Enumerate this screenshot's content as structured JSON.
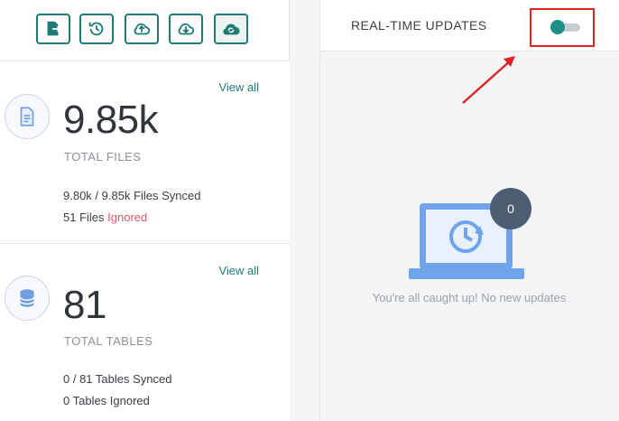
{
  "toolbar": {
    "buttons": [
      {
        "name": "export-file",
        "icon": "file-export-icon"
      },
      {
        "name": "restore",
        "icon": "history-icon"
      },
      {
        "name": "upload",
        "icon": "cloud-upload-icon"
      },
      {
        "name": "download",
        "icon": "cloud-download-icon"
      },
      {
        "name": "sync",
        "icon": "cloud-sync-icon"
      }
    ],
    "accent": "#1f7a75"
  },
  "files": {
    "view_all": "View all",
    "count": "9.85k",
    "label": "TOTAL FILES",
    "synced_count": "9.80k / 9.85k",
    "synced_text": "Files Synced",
    "ignored_count": "51",
    "ignored_files_word": "Files",
    "ignored_text": "Ignored",
    "icon": "file-icon"
  },
  "tables": {
    "view_all": "View all",
    "count": "81",
    "label": "TOTAL TABLES",
    "synced_count": "0 / 81",
    "synced_text": "Tables Synced",
    "ignored_text": "0 Tables Ignored",
    "icon": "database-icon"
  },
  "realtime": {
    "title": "REAL-TIME UPDATES",
    "toggle_on": false,
    "update_count": "0",
    "empty_message": "You're all caught up! No new updates",
    "highlight_color": "#e02424",
    "illustration_icon": "laptop-refresh-icon"
  }
}
